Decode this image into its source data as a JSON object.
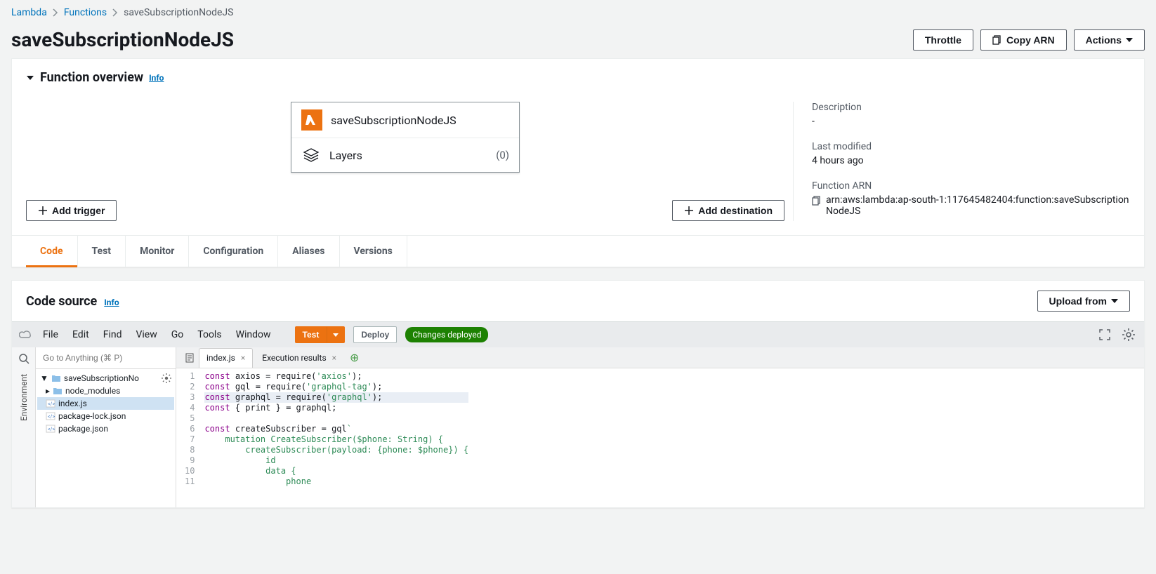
{
  "breadcrumb": {
    "items": [
      "Lambda",
      "Functions",
      "saveSubscriptionNodeJS"
    ]
  },
  "title": "saveSubscriptionNodeJS",
  "header_actions": {
    "throttle": "Throttle",
    "copy_arn": "Copy ARN",
    "actions": "Actions"
  },
  "overview": {
    "heading": "Function overview",
    "info": "Info",
    "function_name": "saveSubscriptionNodeJS",
    "layers_label": "Layers",
    "layers_count": "(0)",
    "add_trigger": "Add trigger",
    "add_destination": "Add destination",
    "description_label": "Description",
    "description_value": "-",
    "last_modified_label": "Last modified",
    "last_modified_value": "4 hours ago",
    "arn_label": "Function ARN",
    "arn_value": "arn:aws:lambda:ap-south-1:117645482404:function:saveSubscriptionNodeJS"
  },
  "tabs": [
    "Code",
    "Test",
    "Monitor",
    "Configuration",
    "Aliases",
    "Versions"
  ],
  "code_source": {
    "heading": "Code source",
    "info": "Info",
    "upload_from": "Upload from"
  },
  "editor": {
    "menus": [
      "File",
      "Edit",
      "Find",
      "View",
      "Go",
      "Tools",
      "Window"
    ],
    "test": "Test",
    "deploy": "Deploy",
    "deploy_status": "Changes deployed",
    "goto_placeholder": "Go to Anything (⌘ P)",
    "side_label": "Environment",
    "tree_root": "saveSubscriptionNo",
    "tree_node_modules": "node_modules",
    "tree_files": [
      "index.js",
      "package-lock.json",
      "package.json"
    ],
    "tabs": [
      {
        "label": "index.js",
        "closable": true
      },
      {
        "label": "Execution results",
        "closable": true
      }
    ],
    "code": [
      {
        "n": 1,
        "html": "<span class='kw'>const</span> <span class='name'>axios</span> = require(<span class='str'>'axios'</span>);"
      },
      {
        "n": 2,
        "html": "<span class='kw'>const</span> <span class='name'>gql</span> = require(<span class='str'>'graphql-tag'</span>);"
      },
      {
        "n": 3,
        "html": "<span class='kw'>const</span> <span class='name'>graphql</span> = require(<span class='str'>'graphql'</span>);",
        "active": true
      },
      {
        "n": 4,
        "html": "<span class='kw'>const</span> { <span class='name'>print</span> } = graphql;"
      },
      {
        "n": 5,
        "html": ""
      },
      {
        "n": 6,
        "html": "<span class='kw'>const</span> <span class='name'>createSubscriber</span> = gql<span class='str'>`</span>"
      },
      {
        "n": 7,
        "html": "<span class='str'>    mutation CreateSubscriber($phone: String) {</span>"
      },
      {
        "n": 8,
        "html": "<span class='str'>        createSubscriber(payload: {phone: $phone}) {</span>"
      },
      {
        "n": 9,
        "html": "<span class='str'>            id</span>"
      },
      {
        "n": 10,
        "html": "<span class='str'>            data {</span>"
      },
      {
        "n": 11,
        "html": "<span class='str'>                phone</span>"
      }
    ]
  }
}
